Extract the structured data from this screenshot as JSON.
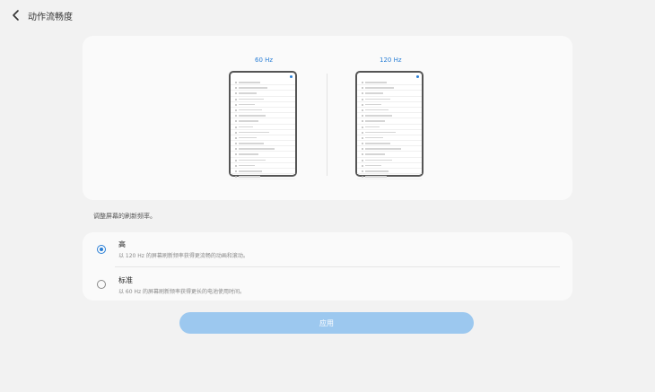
{
  "header": {
    "title": "动作流畅度",
    "back_icon": "chevron-left-icon"
  },
  "preview": {
    "left_label": "60 Hz",
    "right_label": "120 Hz"
  },
  "description": "调整屏幕的刷新频率。",
  "options": [
    {
      "title": "高",
      "subtitle": "以 120 Hz 的屏幕刷新频率获得更流畅的动画和滚动。",
      "selected": true
    },
    {
      "title": "标准",
      "subtitle": "以 60 Hz 的屏幕刷新频率获得更长的电池使用时间。",
      "selected": false
    }
  ],
  "apply_label": "应用",
  "colors": {
    "accent": "#2a7fd6",
    "apply_bg": "#9cc8ef",
    "background": "#f2f2f2",
    "card": "#fafafa"
  }
}
